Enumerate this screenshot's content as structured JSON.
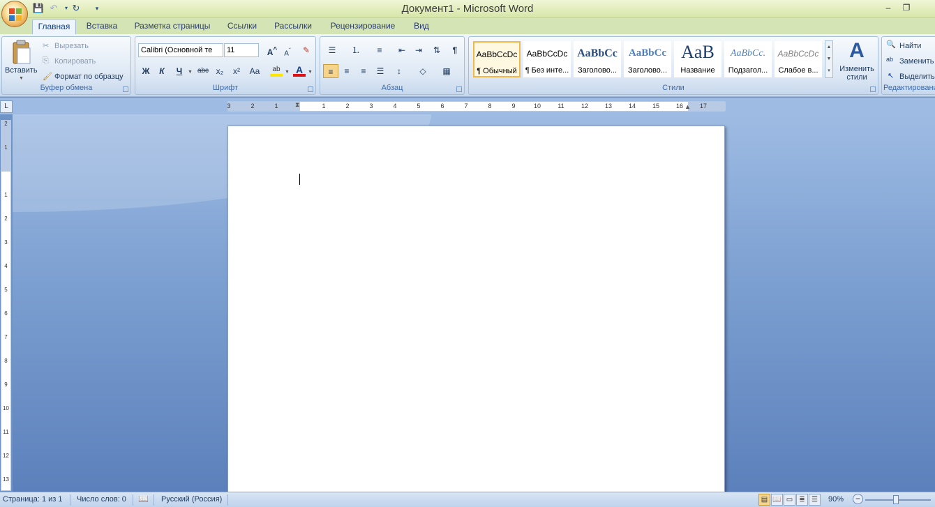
{
  "window": {
    "title": "Документ1 - Microsoft Word"
  },
  "tabs": [
    "Главная",
    "Вставка",
    "Разметка страницы",
    "Ссылки",
    "Рассылки",
    "Рецензирование",
    "Вид"
  ],
  "clipboard": {
    "paste": "Вставить",
    "cut": "Вырезать",
    "copy": "Копировать",
    "format_painter": "Формат по образцу",
    "label": "Буфер обмена"
  },
  "font": {
    "name": "Calibri (Основной те",
    "size": "11",
    "label": "Шрифт",
    "bold": "Ж",
    "italic": "К",
    "underline": "Ч",
    "strike": "abc",
    "sub": "x₂",
    "sup": "x²",
    "case": "Aa"
  },
  "paragraph": {
    "label": "Абзац"
  },
  "styles": {
    "label": "Стили",
    "items": [
      {
        "sample": "AaBbCcDc",
        "name": "¶ Обычный"
      },
      {
        "sample": "AaBbCcDc",
        "name": "¶ Без инте..."
      },
      {
        "sample": "AaBbCc",
        "name": "Заголово..."
      },
      {
        "sample": "AaBbCc",
        "name": "Заголово..."
      },
      {
        "sample": "AaB",
        "name": "Название"
      },
      {
        "sample": "AaBbCc.",
        "name": "Подзагол..."
      },
      {
        "sample": "AaBbCcDc",
        "name": "Слабое в..."
      }
    ],
    "change": "Изменить стили"
  },
  "editing": {
    "find": "Найти",
    "replace": "Заменить",
    "select": "Выделить",
    "label": "Редактирование"
  },
  "ruler": {
    "h_left": [
      "3",
      "2",
      "1"
    ],
    "h_right": [
      "1",
      "2",
      "3",
      "4",
      "5",
      "6",
      "7",
      "8",
      "9",
      "10",
      "11",
      "12",
      "13",
      "14",
      "15",
      "16",
      "17"
    ],
    "v_top": [
      "2",
      "1"
    ],
    "v_bottom": [
      "1",
      "2",
      "3",
      "4",
      "5",
      "6",
      "7",
      "8",
      "9",
      "10",
      "11",
      "12",
      "13"
    ]
  },
  "status": {
    "page": "Страница: 1 из 1",
    "words": "Число слов: 0",
    "language": "Русский (Россия)",
    "zoom": "90%"
  }
}
